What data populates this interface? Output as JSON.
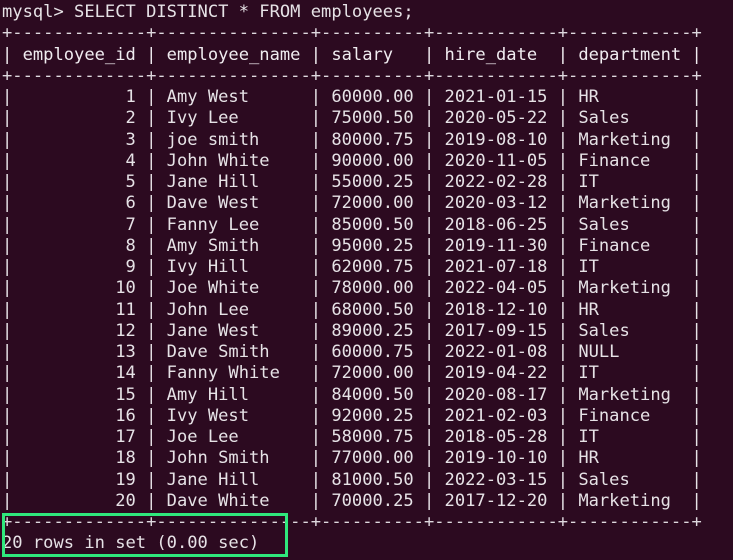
{
  "terminal": {
    "background_color": "#2c0a20",
    "text_color": "#e6e2e6",
    "highlight_color": "#2fe87c",
    "prompt_line": "mysql> SELECT DISTINCT * FROM employees;",
    "separator": "+-------------+---------------+----------+------------+------------+",
    "header_line": "| employee_id | employee_name | salary   | hire_date  | department |",
    "status_line": "20 rows in set (0.00 sec)",
    "columns": [
      "employee_id",
      "employee_name",
      "salary",
      "hire_date",
      "department"
    ],
    "row_count_label": "20 rows in set",
    "elapsed_label": "(0.00 sec)",
    "rows": [
      {
        "employee_id": "1",
        "employee_name": "Amy West",
        "salary": "60000.00",
        "hire_date": "2021-01-15",
        "department": "HR",
        "text": "|           1 | Amy West      | 60000.00 | 2021-01-15 | HR         |"
      },
      {
        "employee_id": "2",
        "employee_name": "Ivy Lee",
        "salary": "75000.50",
        "hire_date": "2020-05-22",
        "department": "Sales",
        "text": "|           2 | Ivy Lee       | 75000.50 | 2020-05-22 | Sales      |"
      },
      {
        "employee_id": "3",
        "employee_name": "joe smith",
        "salary": "80000.75",
        "hire_date": "2019-08-10",
        "department": "Marketing",
        "text": "|           3 | joe smith     | 80000.75 | 2019-08-10 | Marketing  |"
      },
      {
        "employee_id": "4",
        "employee_name": "John White",
        "salary": "90000.00",
        "hire_date": "2020-11-05",
        "department": "Finance",
        "text": "|           4 | John White    | 90000.00 | 2020-11-05 | Finance    |"
      },
      {
        "employee_id": "5",
        "employee_name": "Jane Hill",
        "salary": "55000.25",
        "hire_date": "2022-02-28",
        "department": "IT",
        "text": "|           5 | Jane Hill     | 55000.25 | 2022-02-28 | IT         |"
      },
      {
        "employee_id": "6",
        "employee_name": "Dave West",
        "salary": "72000.00",
        "hire_date": "2020-03-12",
        "department": "Marketing",
        "text": "|           6 | Dave West     | 72000.00 | 2020-03-12 | Marketing  |"
      },
      {
        "employee_id": "7",
        "employee_name": "Fanny Lee",
        "salary": "85000.50",
        "hire_date": "2018-06-25",
        "department": "Sales",
        "text": "|           7 | Fanny Lee     | 85000.50 | 2018-06-25 | Sales      |"
      },
      {
        "employee_id": "8",
        "employee_name": "Amy Smith",
        "salary": "95000.25",
        "hire_date": "2019-11-30",
        "department": "Finance",
        "text": "|           8 | Amy Smith     | 95000.25 | 2019-11-30 | Finance    |"
      },
      {
        "employee_id": "9",
        "employee_name": "Ivy Hill",
        "salary": "62000.75",
        "hire_date": "2021-07-18",
        "department": "IT",
        "text": "|           9 | Ivy Hill      | 62000.75 | 2021-07-18 | IT         |"
      },
      {
        "employee_id": "10",
        "employee_name": "Joe White",
        "salary": "78000.00",
        "hire_date": "2022-04-05",
        "department": "Marketing",
        "text": "|          10 | Joe White     | 78000.00 | 2022-04-05 | Marketing  |"
      },
      {
        "employee_id": "11",
        "employee_name": "John Lee",
        "salary": "68000.50",
        "hire_date": "2018-12-10",
        "department": "HR",
        "text": "|          11 | John Lee      | 68000.50 | 2018-12-10 | HR         |"
      },
      {
        "employee_id": "12",
        "employee_name": "Jane West",
        "salary": "89000.25",
        "hire_date": "2017-09-15",
        "department": "Sales",
        "text": "|          12 | Jane West     | 89000.25 | 2017-09-15 | Sales      |"
      },
      {
        "employee_id": "13",
        "employee_name": "Dave Smith",
        "salary": "60000.75",
        "hire_date": "2022-01-08",
        "department": "NULL",
        "text": "|          13 | Dave Smith    | 60000.75 | 2022-01-08 | NULL       |"
      },
      {
        "employee_id": "14",
        "employee_name": "Fanny White",
        "salary": "72000.00",
        "hire_date": "2019-04-22",
        "department": "IT",
        "text": "|          14 | Fanny White   | 72000.00 | 2019-04-22 | IT         |"
      },
      {
        "employee_id": "15",
        "employee_name": "Amy Hill",
        "salary": "84000.50",
        "hire_date": "2020-08-17",
        "department": "Marketing",
        "text": "|          15 | Amy Hill      | 84000.50 | 2020-08-17 | Marketing  |"
      },
      {
        "employee_id": "16",
        "employee_name": "Ivy West",
        "salary": "92000.25",
        "hire_date": "2021-02-03",
        "department": "Finance",
        "text": "|          16 | Ivy West      | 92000.25 | 2021-02-03 | Finance    |"
      },
      {
        "employee_id": "17",
        "employee_name": "Joe Lee",
        "salary": "58000.75",
        "hire_date": "2018-05-28",
        "department": "IT",
        "text": "|          17 | Joe Lee       | 58000.75 | 2018-05-28 | IT         |"
      },
      {
        "employee_id": "18",
        "employee_name": "John Smith",
        "salary": "77000.00",
        "hire_date": "2019-10-10",
        "department": "HR",
        "text": "|          18 | John Smith    | 77000.00 | 2019-10-10 | HR         |"
      },
      {
        "employee_id": "19",
        "employee_name": "Jane Hill",
        "salary": "81000.50",
        "hire_date": "2022-03-15",
        "department": "Sales",
        "text": "|          19 | Jane Hill     | 81000.50 | 2022-03-15 | Sales      |"
      },
      {
        "employee_id": "20",
        "employee_name": "Dave White",
        "salary": "70000.25",
        "hire_date": "2017-12-20",
        "department": "Marketing",
        "text": "|          20 | Dave White    | 70000.25 | 2017-12-20 | Marketing  |"
      }
    ]
  }
}
